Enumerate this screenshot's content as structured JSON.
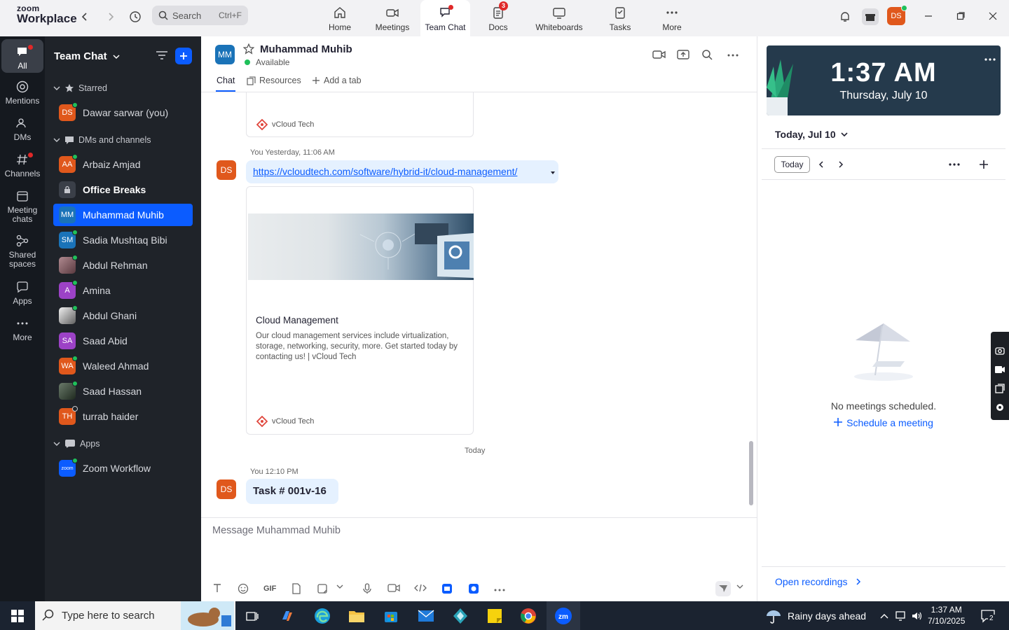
{
  "app": {
    "logo_line1": "zoom",
    "logo_line2": "Workplace"
  },
  "search": {
    "label": "Search",
    "shortcut": "Ctrl+F"
  },
  "nav": [
    {
      "label": "Home"
    },
    {
      "label": "Meetings"
    },
    {
      "label": "Team Chat"
    },
    {
      "label": "Docs",
      "badge": "3"
    },
    {
      "label": "Whiteboards"
    },
    {
      "label": "Tasks"
    },
    {
      "label": "More"
    }
  ],
  "user_avatar": "DS",
  "rail": [
    {
      "label": "All"
    },
    {
      "label": "Mentions"
    },
    {
      "label": "DMs"
    },
    {
      "label": "Channels"
    },
    {
      "label": "Meeting chats"
    },
    {
      "label": "Shared spaces"
    },
    {
      "label": "Apps"
    },
    {
      "label": "More"
    }
  ],
  "sidebar": {
    "title": "Team Chat",
    "sections": {
      "starred": "Starred",
      "dms": "DMs and channels",
      "apps": "Apps"
    },
    "starred": [
      {
        "initials": "DS",
        "name": "Dawar sarwar (you)",
        "color": "#e0581c"
      }
    ],
    "items": [
      {
        "initials": "AA",
        "name": "Arbaiz Amjad",
        "color": "#e0581c"
      },
      {
        "initials": "",
        "name": "Office Breaks",
        "color": "#3a3f48"
      },
      {
        "initials": "MM",
        "name": "Muhammad Muhib",
        "color": "#1a73b8"
      },
      {
        "initials": "SM",
        "name": "Sadia Mushtaq Bibi",
        "color": "#1a73b8"
      },
      {
        "initials": "",
        "name": "Abdul Rehman",
        "color": "#8a6a70"
      },
      {
        "initials": "A",
        "name": "Amina",
        "color": "#9c42c6"
      },
      {
        "initials": "",
        "name": "Abdul Ghani",
        "color": "#d9d9d9"
      },
      {
        "initials": "SA",
        "name": "Saad Abid",
        "color": "#9c42c6"
      },
      {
        "initials": "WA",
        "name": "Waleed Ahmad",
        "color": "#e0581c"
      },
      {
        "initials": "",
        "name": "Saad Hassan",
        "color": "#3c4a3c"
      },
      {
        "initials": "TH",
        "name": "turrab haider",
        "color": "#e0581c"
      }
    ],
    "apps": [
      {
        "initials": "zoom",
        "name": "Zoom Workflow",
        "color": "#0b5cff"
      }
    ]
  },
  "chat": {
    "avatar": "MM",
    "name": "Muhammad Muhib",
    "status": "Available",
    "tabs": {
      "chat": "Chat",
      "resources": "Resources",
      "add": "Add a tab"
    },
    "messages": {
      "site": "vCloud Tech",
      "m1_meta": "You Yesterday, 11:06 AM",
      "m1_avatar": "DS",
      "m1_link": "https://vcloudtech.com/software/hybrid-it/cloud-management/",
      "card_title": "Cloud Management",
      "card_desc": "Our cloud management services include virtualization, storage, networking, security, more. Get started today by contacting us! | vCloud Tech",
      "day_sep": "Today",
      "m2_meta": "You 12:10 PM",
      "m2_avatar": "DS",
      "m2_text": "Task # 001v-16"
    },
    "compose_placeholder": "Message Muhammad Muhib",
    "gif_label": "GIF"
  },
  "right": {
    "time": "1:37 AM",
    "date": "Thursday, July 10",
    "title": "Today, Jul 10",
    "today_btn": "Today",
    "empty": "No meetings scheduled.",
    "schedule": "Schedule a meeting",
    "open_recordings": "Open recordings"
  },
  "taskbar": {
    "search_placeholder": "Type here to search",
    "weather": "Rainy days ahead",
    "time": "1:37 AM",
    "date": "7/10/2025",
    "notif_count": "2"
  },
  "colors": {
    "accent": "#0b5cff",
    "rail_bg": "#15191f",
    "side_bg": "#1f2329",
    "badge": "#e02828"
  }
}
